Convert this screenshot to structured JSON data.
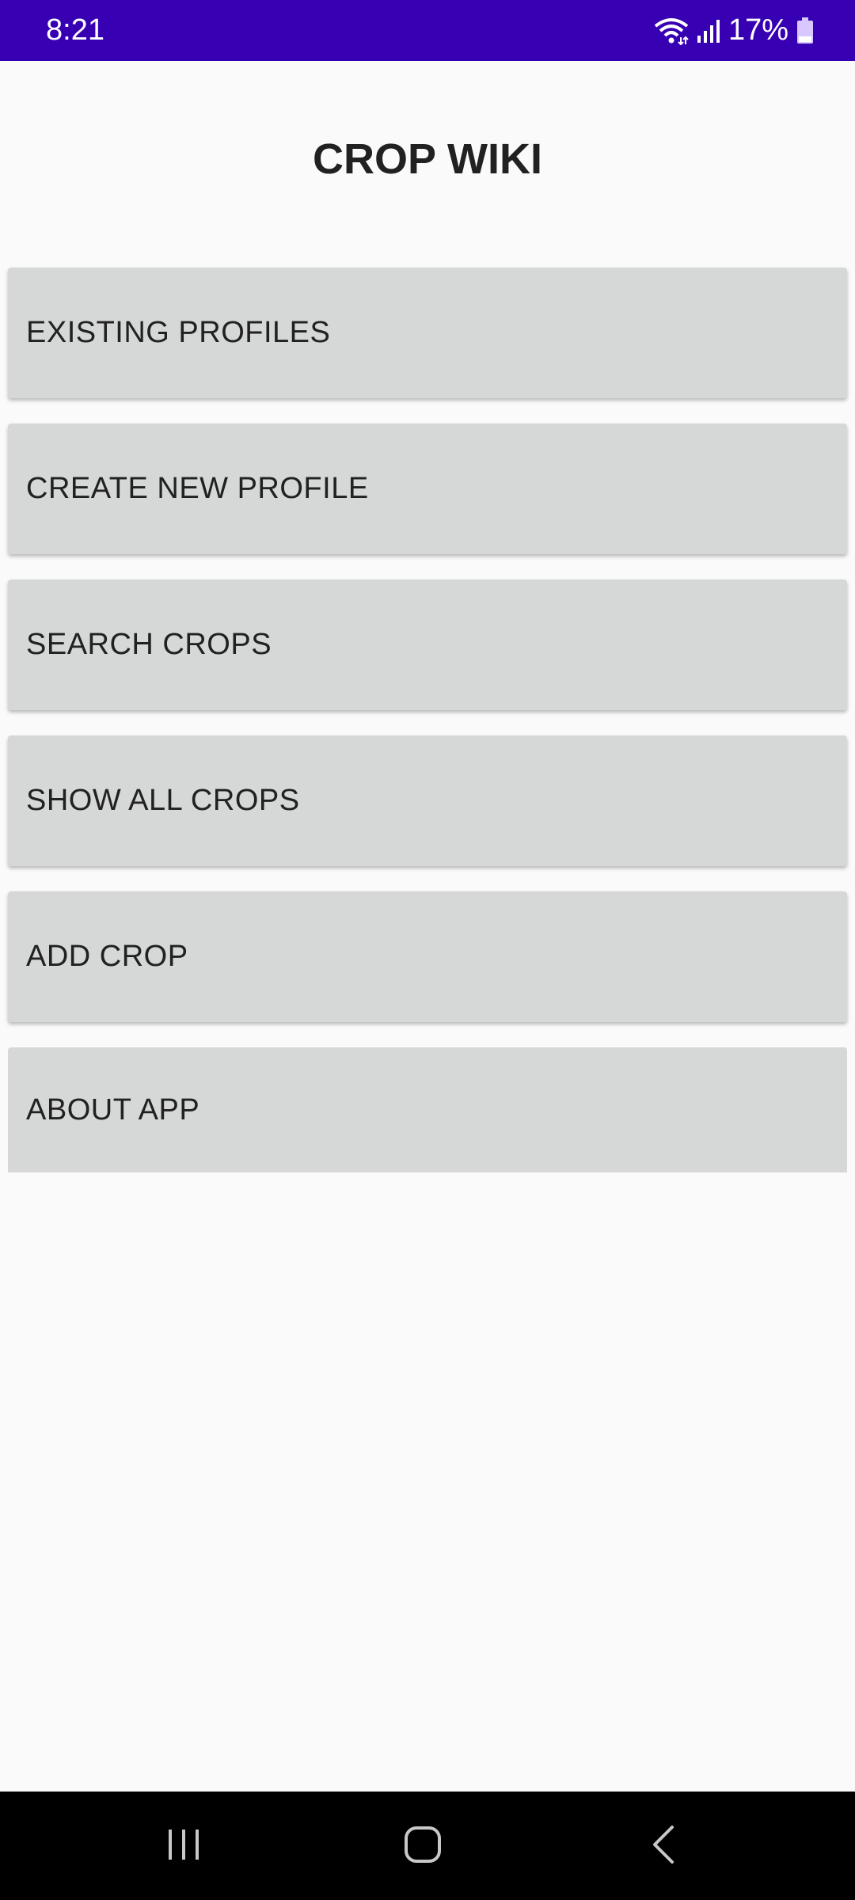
{
  "status_bar": {
    "time": "8:21",
    "battery_percent": "17%",
    "icons": [
      "wifi-icon",
      "signal-icon",
      "battery-icon"
    ],
    "background_color": "#3700b3"
  },
  "page": {
    "title": "CROP WIKI"
  },
  "menu": {
    "items": [
      {
        "label": "EXISTING PROFILES"
      },
      {
        "label": "CREATE NEW PROFILE"
      },
      {
        "label": "SEARCH CROPS"
      },
      {
        "label": "SHOW ALL CROPS"
      },
      {
        "label": "ADD CROP"
      },
      {
        "label": "ABOUT APP"
      }
    ],
    "button_color": "#d6d7d7"
  },
  "nav_bar": {
    "buttons": [
      "recents-icon",
      "home-icon",
      "back-icon"
    ]
  }
}
